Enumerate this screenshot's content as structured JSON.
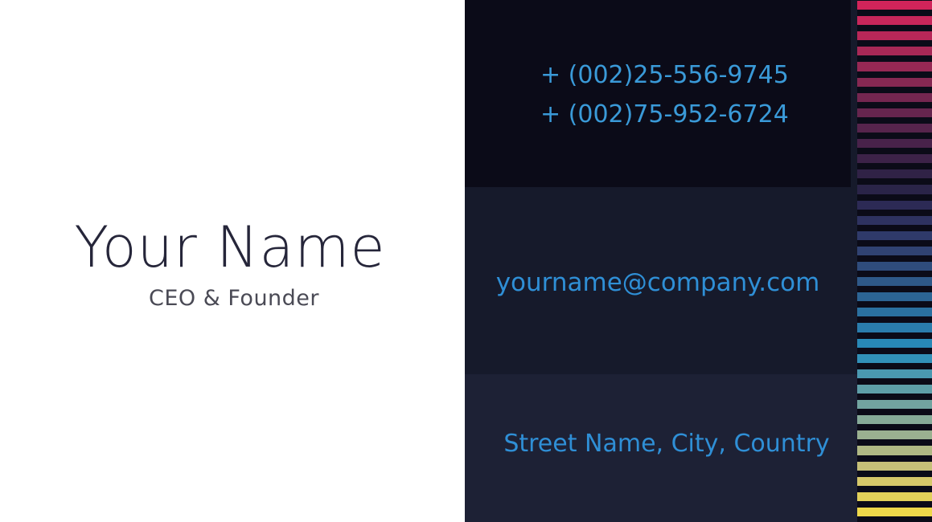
{
  "card": {
    "name": "Your Name",
    "role": "CEO & Founder",
    "phones": [
      "+ (002)25-556-9745",
      "+ (002)75-952-6724"
    ],
    "email": "yourname@company.com",
    "address": "Street Name, City, Country"
  },
  "colors": {
    "background_left": "#ffffff",
    "name_text": "#26263a",
    "role_text": "#4a4a55",
    "panel_dark_1": "#0b0b18",
    "panel_dark_2": "#161a2b",
    "panel_dark_3": "#1d2135",
    "contact_text": "#2f8fd6",
    "stripes": [
      "#d2245a",
      "#c8265a",
      "#b82758",
      "#a82856",
      "#962854",
      "#862852",
      "#742650",
      "#66254e",
      "#56244c",
      "#48224a",
      "#3c2248",
      "#302246",
      "#2a2448",
      "#2c2a55",
      "#2e3260",
      "#2f3a6a",
      "#304272",
      "#2f4c7c",
      "#2e5888",
      "#2c6494",
      "#2a70a0",
      "#2a7cac",
      "#2888b6",
      "#3190b8",
      "#4a98b0",
      "#5e9ea8",
      "#72a4a0",
      "#86aa98",
      "#9ab090",
      "#b0b884",
      "#c6c078",
      "#d6c86a",
      "#e2d05a",
      "#eed84a"
    ]
  }
}
